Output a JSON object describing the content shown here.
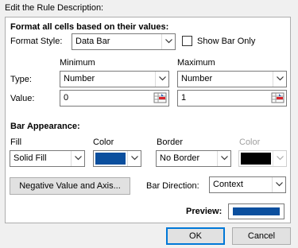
{
  "section_title": "Edit the Rule Description:",
  "format_heading": "Format all cells based on their values:",
  "format_style": {
    "label": "Format Style:",
    "value": "Data Bar"
  },
  "show_bar_only": {
    "label": "Show Bar Only",
    "checked": false
  },
  "minimum": {
    "heading": "Minimum",
    "type_value": "Number",
    "value": "0"
  },
  "maximum": {
    "heading": "Maximum",
    "type_value": "Number",
    "value": "1"
  },
  "row_labels": {
    "type": "Type:",
    "value": "Value:"
  },
  "bar_appearance": {
    "heading": "Bar Appearance:",
    "fill_label": "Fill",
    "fill_value": "Solid Fill",
    "color_label": "Color",
    "fill_color": "#0b4f9e",
    "border_label": "Border",
    "border_value": "No Border",
    "border_color_label": "Color",
    "border_color": "#000000"
  },
  "negative_button": "Negative Value and Axis...",
  "bar_direction": {
    "label": "Bar Direction:",
    "value": "Context"
  },
  "preview": {
    "label": "Preview:",
    "color": "#0b4f9e"
  },
  "ok_button": "OK",
  "cancel_button": "Cancel",
  "icons": [
    "chevron-down-icon",
    "cell-reference-icon",
    "checkbox-icon"
  ]
}
